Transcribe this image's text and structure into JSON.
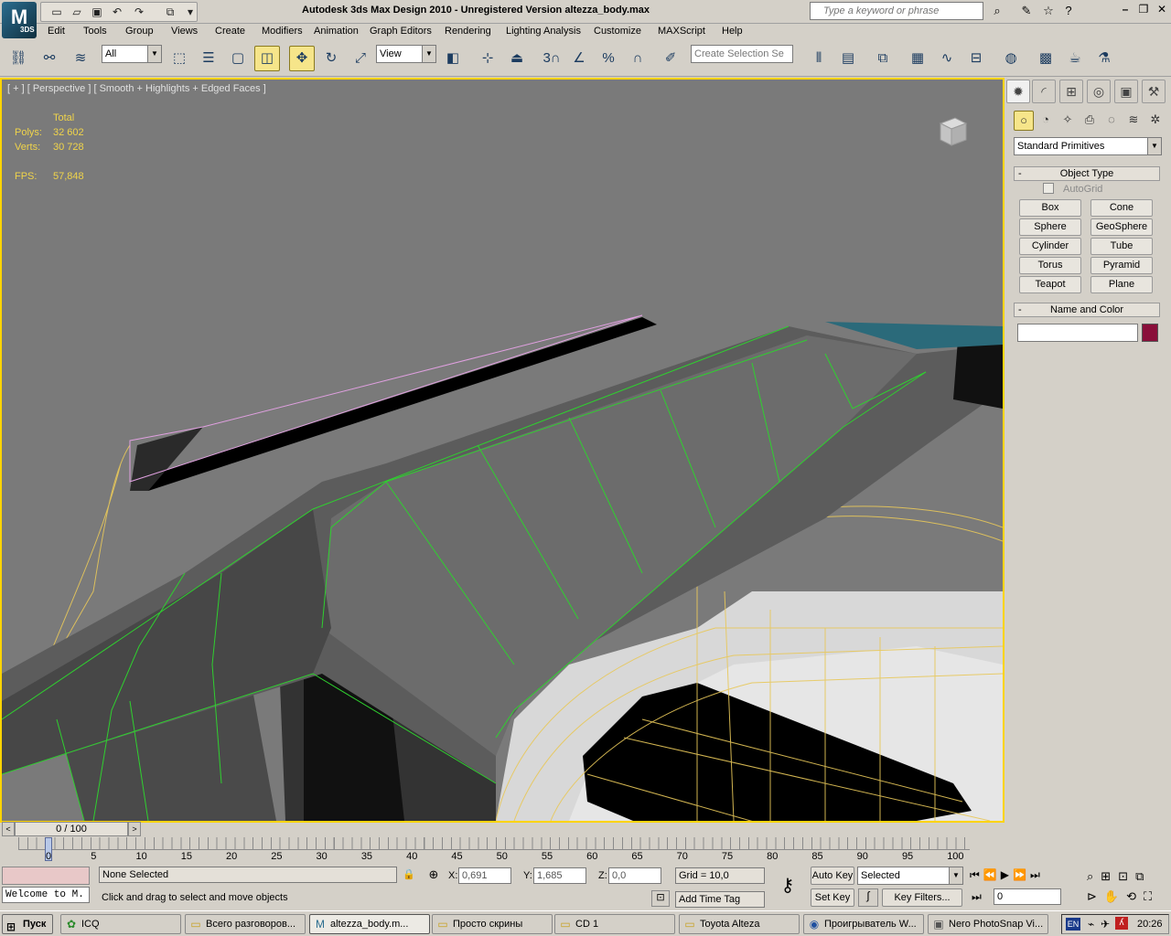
{
  "app": {
    "logo_text": "3DS",
    "window_title": "Autodesk 3ds Max Design 2010 - Unregistered Version    altezza_body.max",
    "search_placeholder": "Type a keyword or phrase"
  },
  "menu": [
    "Edit",
    "Tools",
    "Group",
    "Views",
    "Create",
    "Modifiers",
    "Animation",
    "Graph Editors",
    "Rendering",
    "Lighting Analysis",
    "Customize",
    "MAXScript",
    "Help"
  ],
  "toolbar": {
    "selection_filter": "All",
    "reference_coord": "View",
    "named_selection_placeholder": "Create Selection Se",
    "snap_3d": "3",
    "angle_snap": "%",
    "percent_snap": "%"
  },
  "viewport": {
    "label": "[ + ] [ Perspective ] [ Smooth + Highlights + Edged Faces ]",
    "stats_header": "Total",
    "polys_label": "Polys:",
    "polys_value": "32 602",
    "verts_label": "Verts:",
    "verts_value": "30 728",
    "fps_label": "FPS:",
    "fps_value": "57,848"
  },
  "command_panel": {
    "category_dropdown": "Standard Primitives",
    "object_type_title": "Object Type",
    "autogrid_label": "AutoGrid",
    "primitives": [
      "Box",
      "Cone",
      "Sphere",
      "GeoSphere",
      "Cylinder",
      "Tube",
      "Torus",
      "Pyramid",
      "Teapot",
      "Plane"
    ],
    "name_color_title": "Name and Color",
    "object_color": "#8a0f3a"
  },
  "time": {
    "slider_label": "0 / 100",
    "ticks": [
      "0",
      "5",
      "10",
      "15",
      "20",
      "25",
      "30",
      "35",
      "40",
      "45",
      "50",
      "55",
      "60",
      "65",
      "70",
      "75",
      "80",
      "85",
      "90",
      "95",
      "100"
    ]
  },
  "status": {
    "maxscript_listener": "Welcome to M.",
    "selection_status": "None Selected",
    "prompt": "Click and drag to select and move objects",
    "x_label": "X:",
    "x_value": "0,691",
    "y_label": "Y:",
    "y_value": "1,685",
    "z_label": "Z:",
    "z_value": "0,0",
    "grid": "Grid = 10,0",
    "add_time_tag": "Add Time Tag",
    "auto_key": "Auto Key",
    "set_key": "Set Key",
    "key_mode_selected": "Selected",
    "key_filters": "Key Filters...",
    "current_frame": "0"
  },
  "taskbar": {
    "start": "Пуск",
    "items": [
      {
        "label": "ICQ",
        "icon": "icq-flower-icon"
      },
      {
        "label": "Всего разговоров...",
        "icon": "folder-icon"
      },
      {
        "label": "altezza_body.m...",
        "icon": "3dsmax-icon"
      },
      {
        "label": "Просто скрины",
        "icon": "folder-icon"
      },
      {
        "label": "CD 1",
        "icon": "folder-icon"
      },
      {
        "label": "Toyota Alteza",
        "icon": "folder-icon"
      },
      {
        "label": "Проигрыватель W...",
        "icon": "media-player-icon"
      },
      {
        "label": "Nero PhotoSnap Vi...",
        "icon": "image-viewer-icon"
      }
    ],
    "language": "EN",
    "clock": "20:26"
  }
}
